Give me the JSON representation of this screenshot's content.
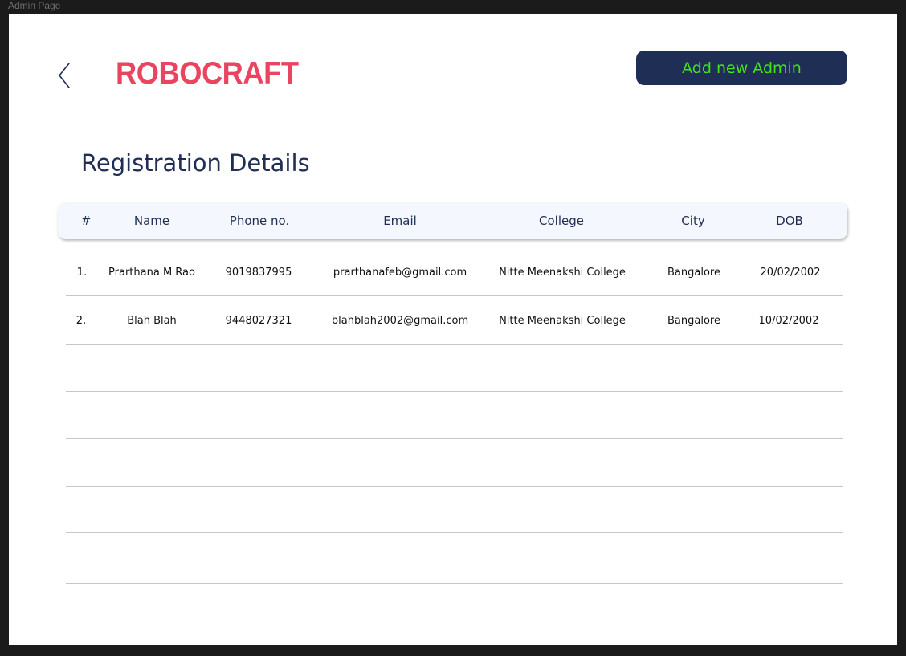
{
  "window": {
    "title": "Admin Page"
  },
  "header": {
    "brand": "ROBOCRAFT",
    "add_button_label": "Add new Admin"
  },
  "page": {
    "title": "Registration Details"
  },
  "table": {
    "columns": [
      "#",
      "Name",
      "Phone no.",
      "Email",
      "College",
      "City",
      "DOB"
    ],
    "rows": [
      [
        "1.",
        "Prarthana M Rao",
        "9019837995",
        "prarthanafeb@gmail.com",
        "Nitte Meenakshi College",
        "Bangalore",
        "20/02/2002"
      ],
      [
        "2.",
        "Blah Blah",
        "9448027321",
        "blahblah2002@gmail.com",
        "Nitte Meenakshi College",
        "Bangalore",
        "10/02/2002"
      ]
    ]
  },
  "colors": {
    "brand": "#e94560",
    "navy": "#1f2e54",
    "button_text": "#44e41a"
  }
}
